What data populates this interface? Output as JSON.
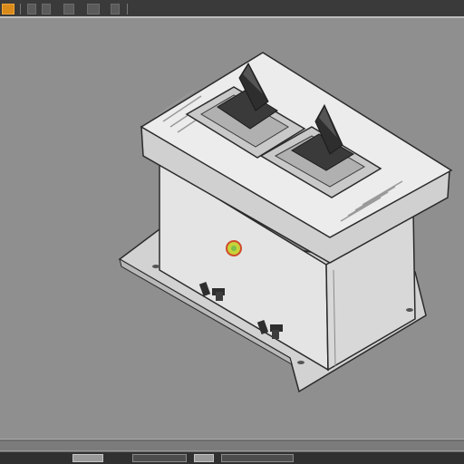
{
  "app": {
    "title_text": ""
  },
  "colors": {
    "toolbar_bg": "#3a3a3a",
    "viewport_bg": "#8f8f8f",
    "active_tool": "#d88a1a",
    "model_body": "#e6e6e6",
    "model_outline": "#2a2a2a",
    "switch_knob": "#2e2e2e",
    "indicator_led": "#c8d23a"
  },
  "toolbar": {
    "icons": [
      "select-tool-icon",
      "move-tool-icon",
      "rotate-tool-icon",
      "scale-tool-icon",
      "view-tool-icon",
      "render-tool-icon"
    ]
  },
  "viewport": {
    "object": "dual-switch-housing-model"
  },
  "timeline": {
    "icons": [
      "play-icon",
      "key-icon"
    ]
  }
}
